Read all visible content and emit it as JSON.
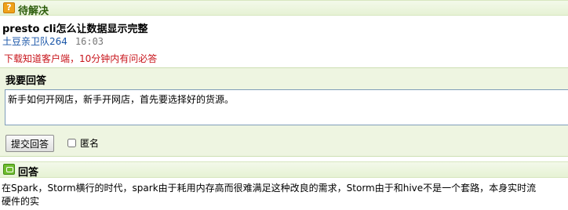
{
  "question_section": {
    "status_label": "待解决",
    "icon": "question-icon",
    "title": "presto cli怎么让数据显示完整",
    "author": "土豆亲卫队264",
    "time": "16:03",
    "promo_link": "下载知道客户端，10分钟内有问必答"
  },
  "answer_form": {
    "heading": "我要回答",
    "input_value": "新手如何开网店，新手开网店，首先要选择好的货源。",
    "submit_label": "提交回答",
    "anonymous_label": "匿名"
  },
  "answers_section": {
    "heading": "回答",
    "icon": "answer-icon",
    "answer_line1": "在Spark，Storm横行的时代，spark由于耗用内存高而很难满足这种改良的需求，Storm由于和hive不是一个套路，本身实时流",
    "answer_line2": "硬件的实"
  },
  "colors": {
    "header_text": "#2e5e0e",
    "link_blue": "#1a56a8",
    "promo_red": "#c8141b",
    "panel_bg": "#eef5e1"
  }
}
